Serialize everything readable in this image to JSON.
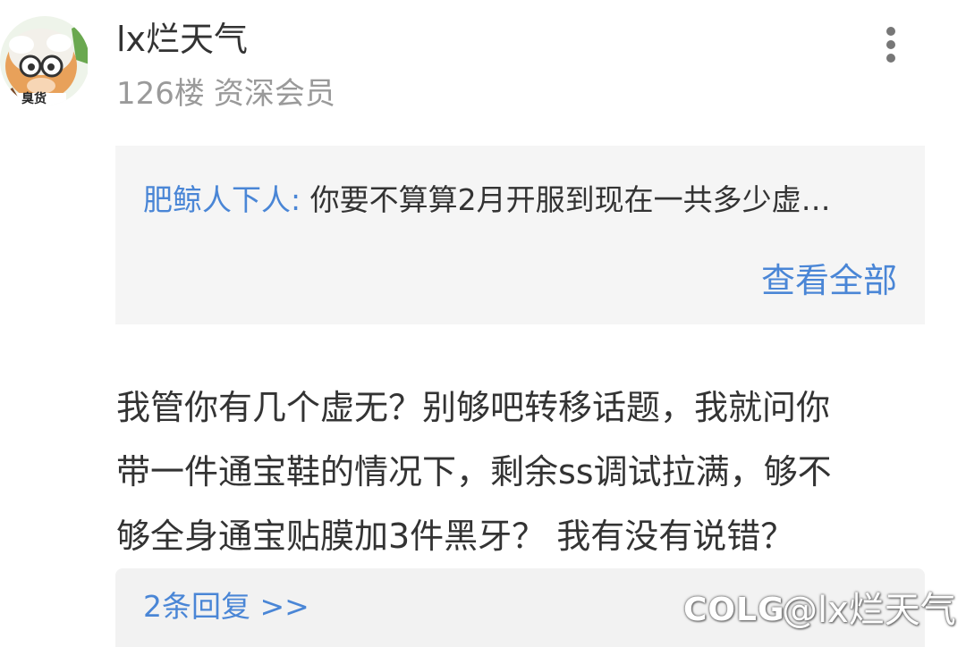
{
  "post": {
    "username": "lx烂天气",
    "floor": "126楼",
    "rank": "资深会员",
    "avatar_badge": "臭货",
    "more_icon": "more-vertical-icon"
  },
  "quote": {
    "author": "肥鲸人下人:",
    "text": "你要不算算2月开服到现在一共多少虚…",
    "view_all": "查看全部"
  },
  "body": {
    "lines": [
      "我管你有几个虚无？别够吧转移话题，我就问你",
      "带一件通宝鞋的情况下，剩余ss调试拉满，够不",
      "够全身通宝贴膜加3件黑牙？ 我有没有说错？"
    ]
  },
  "replies": {
    "label": "2条回复 >>"
  },
  "watermark": {
    "logo": "COLG",
    "handle": "@lx烂天气"
  },
  "colors": {
    "link": "#4a86d6",
    "text": "#333333",
    "muted": "#9a9a9a",
    "panel": "#f5f5f5"
  }
}
